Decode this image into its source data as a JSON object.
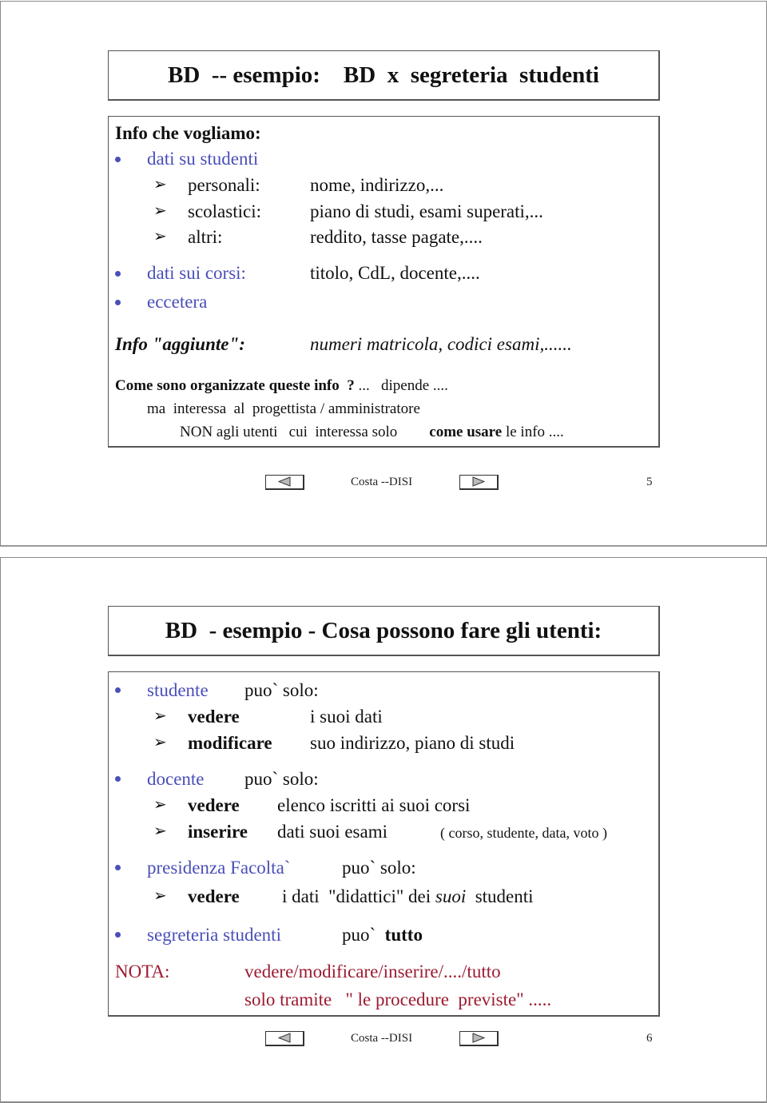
{
  "slides": [
    {
      "title": "BD  -- esempio:    BD  x  segreteria  studenti",
      "heading": "Info che vogliamo:",
      "bullets": [
        {
          "label": "dati su studenti",
          "subitems": [
            {
              "label": "personali:",
              "value": "nome, indirizzo,..."
            },
            {
              "label": "scolastici:",
              "value": "piano di studi, esami superati,..."
            },
            {
              "label": "altri:",
              "value": "reddito, tasse pagate,...."
            }
          ]
        },
        {
          "label": "dati sui corsi:",
          "value": "titolo, CdL, docente,...."
        },
        {
          "label": "eccetera"
        }
      ],
      "extra_label": "Info \"aggiunte\":",
      "extra_value": "numeri matricola, codici esami,......",
      "question_bold": "Come sono organizzate queste info  ?",
      "question_rest": " ...   dipende ....",
      "note_line1": "ma  interessa  al  progettista / amministratore",
      "note_line2_a": "NON agli utenti   cui  interessa solo",
      "note_line2_bold": "come usare",
      "note_line2_b": " le info ....",
      "footer": {
        "prev_icon": "triangle-left-icon",
        "author": "Costa --DISI",
        "next_icon": "triangle-right-icon",
        "page": "5"
      }
    },
    {
      "title": "BD  - esempio - Cosa possono fare gli utenti:",
      "roles": [
        {
          "role": "studente",
          "can": "puo` solo:",
          "actions": [
            {
              "verb": "vedere",
              "object": "i suoi dati"
            },
            {
              "verb": "modificare",
              "object": "suo indirizzo, piano di studi"
            }
          ]
        },
        {
          "role": "docente",
          "can": "puo` solo:",
          "actions": [
            {
              "verb": "vedere",
              "object": "elenco iscritti ai suoi corsi"
            },
            {
              "verb": "inserire",
              "object": "dati suoi esami",
              "detail": "( corso, studente, data, voto )"
            }
          ]
        },
        {
          "role": "presidenza Facolta`",
          "can": "puo` solo:",
          "actions": [
            {
              "verb": "vedere",
              "object_a": "i dati  \"didattici\" dei ",
              "object_italic": "suoi",
              "object_b": "  studenti"
            }
          ]
        },
        {
          "role": "segreteria studenti",
          "can": "puo`",
          "can_bold": "tutto"
        }
      ],
      "nota_label": "NOTA:",
      "nota_line1": "vedere/modificare/inserire/..../tutto",
      "nota_line2": "solo tramite   \" le procedure  previste\" .....",
      "footer": {
        "prev_icon": "triangle-left-icon",
        "author": "Costa --DISI",
        "next_icon": "triangle-right-icon",
        "page": "6"
      }
    }
  ],
  "colors": {
    "accent_blue": "#4a4fb8",
    "note_red": "#9b1b30"
  }
}
